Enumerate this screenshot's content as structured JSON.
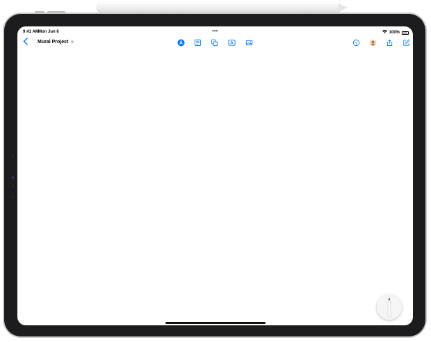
{
  "status_bar": {
    "time": "9:41 AM",
    "date": "Mon Jun 6",
    "battery": "100%"
  },
  "toolbar": {
    "title": "Mural Project",
    "back_icon": "chevron-left-icon",
    "center_tools": [
      {
        "name": "markup-pen-icon"
      },
      {
        "name": "note-icon"
      },
      {
        "name": "shapes-icon"
      },
      {
        "name": "text-box-icon"
      },
      {
        "name": "media-icon"
      }
    ],
    "right_tools": [
      {
        "name": "undo-history-icon"
      },
      {
        "name": "collaborators-avatar-icon"
      },
      {
        "name": "share-icon"
      },
      {
        "name": "new-board-icon"
      }
    ]
  },
  "colors": {
    "accent": "#0a7aff",
    "bezel": "#1c1c1e",
    "frame": "#c9c9cb"
  }
}
